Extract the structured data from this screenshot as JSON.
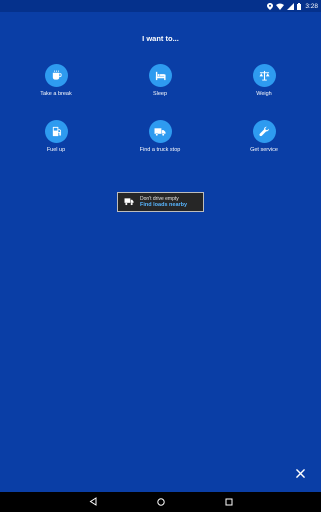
{
  "status_bar": {
    "time": "3:28",
    "icons": [
      "location-icon",
      "wifi-icon",
      "signal-icon",
      "battery-icon"
    ]
  },
  "screen": {
    "heading": "I want to...",
    "actions": [
      {
        "label": "Take a break",
        "icon": "coffee-cup-icon"
      },
      {
        "label": "Sleep",
        "icon": "bed-icon"
      },
      {
        "label": "Weigh",
        "icon": "scale-icon"
      },
      {
        "label": "Fuel up",
        "icon": "fuel-pump-icon"
      },
      {
        "label": "Find a truck stop",
        "icon": "truck-icon"
      },
      {
        "label": "Get service",
        "icon": "wrench-icon"
      }
    ],
    "promo": {
      "line1": "Don't drive empty",
      "line2": "Find loads nearby",
      "icon": "truck-load-icon"
    },
    "close_icon": "close-icon"
  },
  "nav_bar": {
    "buttons": [
      "back-icon",
      "home-icon",
      "recents-icon"
    ]
  },
  "colors": {
    "background": "#0a3ea6",
    "status_bar": "#05318c",
    "icon_circle": "#2e9bf0",
    "promo_background": "#262626",
    "promo_link": "#58b6ff"
  }
}
